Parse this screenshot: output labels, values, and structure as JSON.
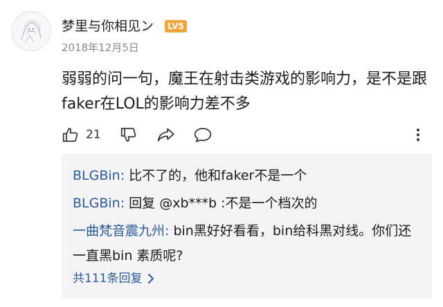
{
  "comment": {
    "username": "梦里与你相见ン",
    "level_badge": "LV5",
    "date": "2018年12月5日",
    "text": "弱弱的问一句，魔王在射击类游戏的影响力，是不是跟faker在LOL的影响力差不多",
    "like_count": "21"
  },
  "actions": {
    "like_icon": "thumbs-up-icon",
    "dislike_icon": "thumbs-down-icon",
    "share_icon": "share-icon",
    "comment_icon": "comment-icon",
    "more_icon": "more-vertical-icon"
  },
  "replies": [
    {
      "author": "BLGBin",
      "separator": ": ",
      "text": "比不了的，他和faker不是一个"
    },
    {
      "author": "BLGBin",
      "separator": ": ",
      "text": "回复 @xb***b :不是一个档次的"
    },
    {
      "author": "一曲梵音震九州",
      "separator": ": ",
      "text": "bin黑好好看看，bin给科黑对线。你们还一直黑bin 素质呢?"
    }
  ],
  "more_replies_label": "共111条回复",
  "colors": {
    "link_blue": "#2b5a9a",
    "badge_orange": "#f2a23b",
    "reply_bg": "#f4f4f6",
    "meta_gray": "#8a8a8a"
  }
}
